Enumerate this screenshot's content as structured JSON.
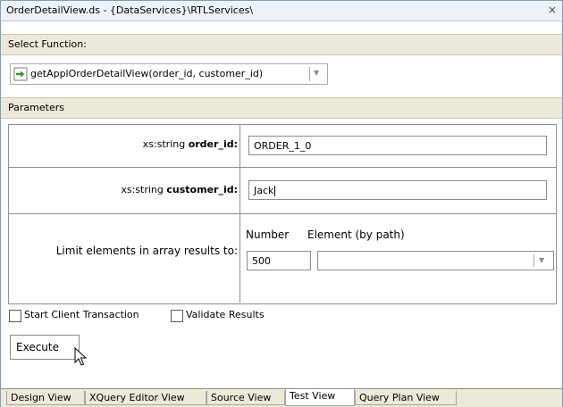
{
  "window": {
    "title": "OrderDetailView.ds - {DataServices}\\RTLServices\\",
    "close_glyph": "×"
  },
  "select_function": {
    "header": "Select Function:",
    "value": "getApplOrderDetailView(order_id, customer_id)",
    "icon": "function-arrow-icon"
  },
  "parameters": {
    "header": "Parameters",
    "order_id": {
      "type": "xs:string",
      "name": "order_id:",
      "value": "ORDER_1_0"
    },
    "customer_id": {
      "type": "xs:string",
      "name": "customer_id:",
      "value": "Jack"
    },
    "limit": {
      "label": "Limit elements in array results to:",
      "number_label": "Number",
      "element_label": "Element (by path)",
      "number_value": "500",
      "element_value": ""
    }
  },
  "options": {
    "start_client_transaction": "Start Client Transaction",
    "validate_results": "Validate Results"
  },
  "execute_label": "Execute",
  "tabs": [
    {
      "label": "Design View",
      "active": false
    },
    {
      "label": "XQuery Editor View",
      "active": false
    },
    {
      "label": "Source View",
      "active": false
    },
    {
      "label": "Test View",
      "active": true
    },
    {
      "label": "Query Plan View",
      "active": false
    }
  ],
  "colors": {
    "accent_green": "#2e9b2e",
    "section_bg": "#ece9d8",
    "border": "#8e8e8e"
  }
}
